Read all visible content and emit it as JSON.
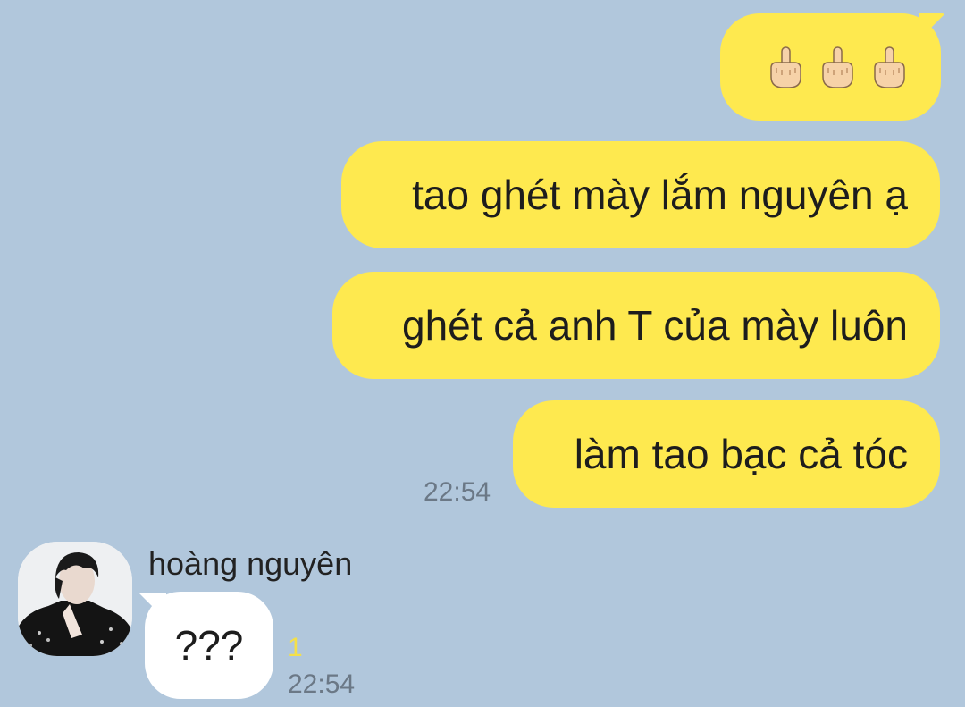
{
  "messages_out": [
    {
      "type": "emoji",
      "icons": [
        "middle-finger-icon",
        "middle-finger-icon",
        "middle-finger-icon"
      ]
    },
    {
      "text": "tao ghét mày lắm nguyên ạ"
    },
    {
      "text": "ghét cả anh T của mày luôn"
    },
    {
      "text": "làm tao bạc cả tóc"
    }
  ],
  "out_time": "22:54",
  "incoming": {
    "sender_name": "hoàng nguyên",
    "text": "???",
    "unread_count": "1",
    "time": "22:54"
  },
  "colors": {
    "background": "#b1c7dc",
    "outgoing_bubble": "#fee94f",
    "incoming_bubble": "#ffffff",
    "unread": "#f4e04a"
  }
}
